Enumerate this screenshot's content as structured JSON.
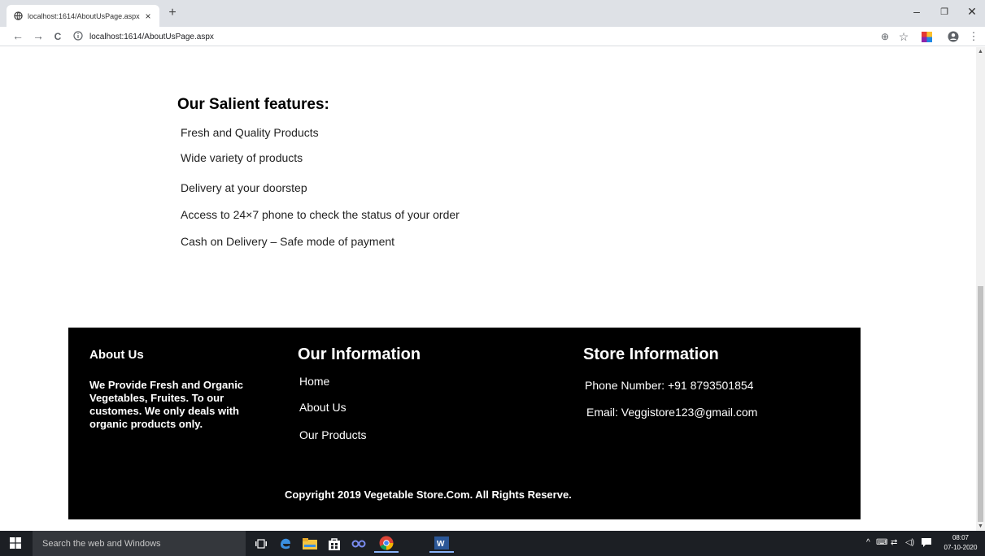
{
  "browser": {
    "tab_title": "localhost:1614/AboutUsPage.aspx",
    "url": "localhost:1614/AboutUsPage.aspx",
    "new_tab_symbol": "+",
    "close_symbol": "×",
    "minimize_symbol": "–",
    "restore_symbol": "❐",
    "window_close_symbol": "✕",
    "back_symbol": "←",
    "forward_symbol": "→",
    "reload_symbol": "C",
    "zoom_symbol": "⊕",
    "star_symbol": "☆",
    "menu_symbol": "⋮"
  },
  "features": {
    "title": "Our Salient features:",
    "items": [
      "Fresh and Quality Products",
      "Wide variety of products",
      "Delivery at your doorstep",
      "Access to 24×7 phone to check the status of your order",
      "Cash on Delivery – Safe mode of payment"
    ]
  },
  "footer": {
    "about_heading": "About Us",
    "about_text": "We Provide Fresh and Organic Vegetables, Fruites. To our customes. We only deals with organic products only.",
    "info_heading": "Our Information",
    "links": [
      "Home",
      "About Us",
      "Our Products"
    ],
    "store_heading": "Store Information",
    "phone": "Phone Number: +91 8793501854",
    "email": "Email: Veggistore123@gmail.com",
    "copyright": "Copyright 2019 Vegetable Store.Com. All Rights Reserve."
  },
  "taskbar": {
    "search_placeholder": "Search the web and Windows",
    "time": "08:07",
    "date": "07-10-2020"
  },
  "colors": {
    "footer_bg": "#000000",
    "taskbar_bg": "#1c1f24"
  }
}
